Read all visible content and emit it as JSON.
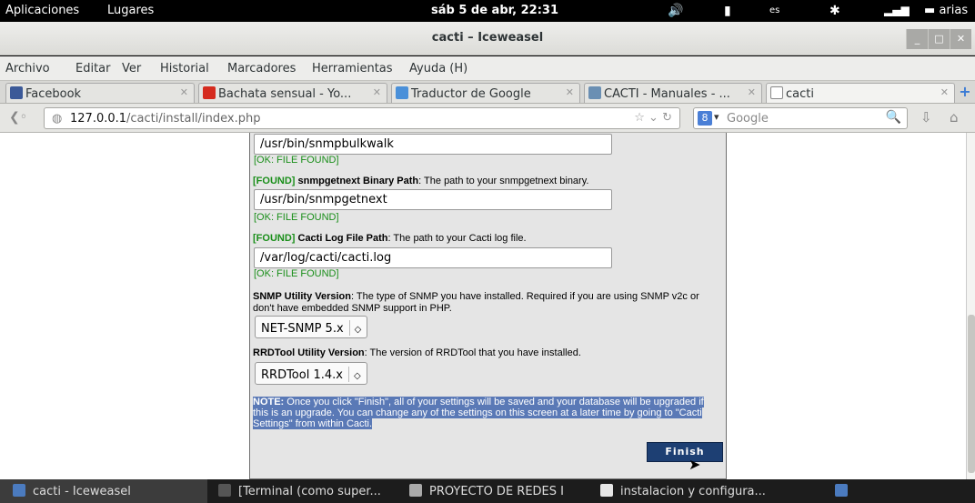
{
  "top_panel": {
    "apps": "Aplicaciones",
    "places": "Lugares",
    "clock": "sáb 5 de abr, 22:31",
    "lang": "es",
    "user": "arias"
  },
  "window": {
    "title": "cacti – Iceweasel"
  },
  "menu": [
    "Archivo",
    "Editar",
    "Ver",
    "Historial",
    "Marcadores",
    "Herramientas",
    "Ayuda (H)"
  ],
  "tabs": [
    {
      "label": "Facebook",
      "icon_color": "#3b5998"
    },
    {
      "label": "Bachata sensual - Yo...",
      "icon_color": "#d52b1e"
    },
    {
      "label": "Traductor de Google",
      "icon_color": "#4a90d9"
    },
    {
      "label": "CACTI - Manuales - ...",
      "icon_color": "#6a8fb3"
    },
    {
      "label": "cacti",
      "icon_color": "#ffffff"
    }
  ],
  "nav": {
    "url_host": "127.0.0.1",
    "url_path": "/cacti/install/index.php",
    "search_placeholder": "Google"
  },
  "install": {
    "bulkwalk_value": "/usr/bin/snmpbulkwalk",
    "bulkwalk_ok": "[OK: FILE FOUND]",
    "getnext_found": "[FOUND]",
    "getnext_title": "snmpgetnext Binary Path",
    "getnext_desc": ": The path to your snmpgetnext binary.",
    "getnext_value": "/usr/bin/snmpgetnext",
    "getnext_ok": "[OK: FILE FOUND]",
    "log_found": "[FOUND]",
    "log_title": "Cacti Log File Path",
    "log_desc": ": The path to your Cacti log file.",
    "log_value": "/var/log/cacti/cacti.log",
    "log_ok": "[OK: FILE FOUND]",
    "snmp_title": "SNMP Utility Version",
    "snmp_desc": ": The type of SNMP you have installed. Required if you are using SNMP v2c or don't have embedded SNMP support in PHP.",
    "snmp_value": "NET-SNMP 5.x",
    "rrd_title": "RRDTool Utility Version",
    "rrd_desc": ": The version of RRDTool that you have installed.",
    "rrd_value": "RRDTool 1.4.x",
    "note_label": "NOTE:",
    "note_text": " Once you click \"Finish\", all of your settings will be saved and your database will be upgraded if this is an upgrade. You can change any of the settings on this screen at a later time by going to \"Cacti Settings\" from within Cacti.",
    "finish_label": "Finish"
  },
  "taskbar": [
    {
      "label": "cacti - Iceweasel",
      "icon_color": "#4b7bbf"
    },
    {
      "label": "[Terminal (como super...",
      "icon_color": "#555555"
    },
    {
      "label": "PROYECTO DE REDES I",
      "icon_color": "#aaaaaa"
    },
    {
      "label": "instalacion y configura...",
      "icon_color": "#e6e6e6"
    }
  ]
}
